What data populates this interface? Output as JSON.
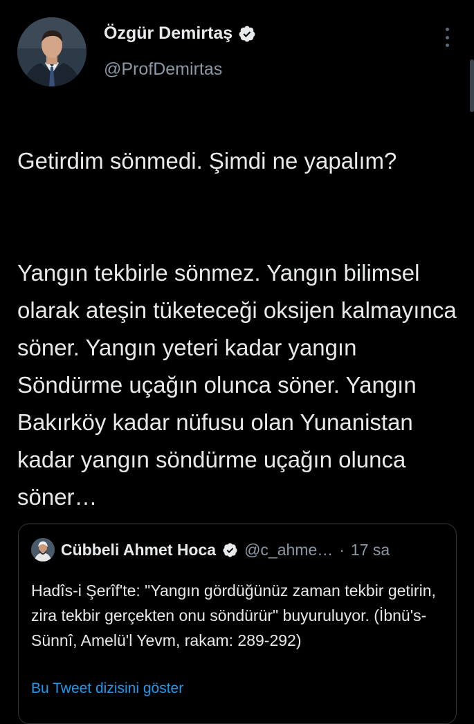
{
  "tweet": {
    "author": {
      "name": "Özgür Demirtaş",
      "handle": "@ProfDemirtas",
      "verified": true,
      "avatar": "profile-photo-man-suit"
    },
    "more_icon": "vertical-ellipsis-icon",
    "text_paragraphs": [
      "Getirdim sönmedi. Şimdi ne yapalım?",
      "Yangın tekbirle sönmez. Yangın bilimsel olarak ateşin tüketeceği oksijen kalmayınca söner. Yangın yeteri kadar yangın Söndürme uçağın olunca söner. Yangın Bakırköy kadar nüfusu olan Yunanistan kadar yangın söndürme uçağın olunca söner…"
    ],
    "quoted": {
      "name": "Cübbeli Ahmet Hoca",
      "handle": "@c_ahme…",
      "separator": "·",
      "time": "17 sa",
      "verified": true,
      "text": "Hadîs-i Şerîf'te: \"Yangın gördüğünüz zaman tekbir getirin, zira tekbir gerçekten onu söndürür\" buyuruluyor. (İbnü's-Sünnî, Amelü'l Yevm, rakam: 289-292)",
      "thread_link": "Bu Tweet dizisini göster"
    }
  },
  "colors": {
    "background": "#000000",
    "text": "#e7e9ea",
    "secondary": "#8b98a5",
    "link": "#1d9bf0",
    "border": "#2f3336"
  }
}
